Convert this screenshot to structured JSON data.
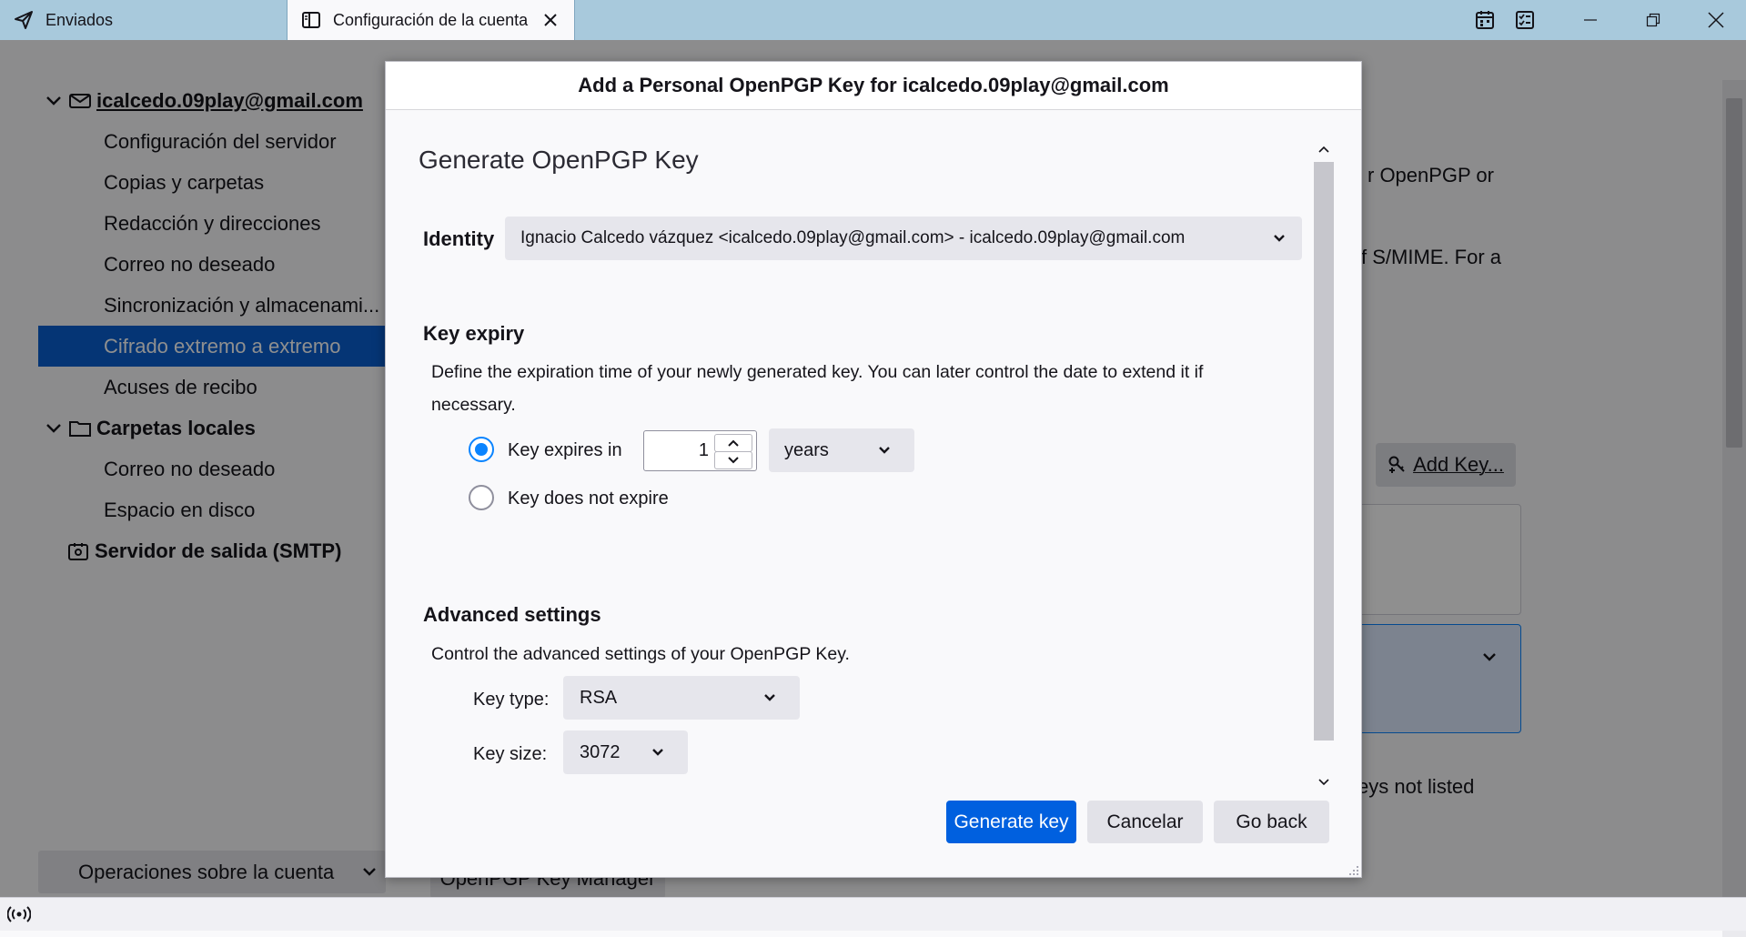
{
  "tabs": [
    {
      "label": "Enviados",
      "icon": "send-icon"
    },
    {
      "label": "Configuración de la cuenta",
      "icon": "settings-page-icon"
    }
  ],
  "window_controls": [
    "calendar-icon",
    "tasks-icon",
    "minimize-icon",
    "restore-icon",
    "close-icon"
  ],
  "sidebar": {
    "account": "icalcedo.09play@gmail.com",
    "account_items": [
      "Configuración del servidor",
      "Copias y carpetas",
      "Redacción y direcciones",
      "Correo no deseado",
      "Sincronización y almacenami...",
      "Cifrado extremo a extremo",
      "Acuses de recibo"
    ],
    "selected_item": "Cifrado extremo a extremo",
    "local_folders": "Carpetas locales",
    "local_items": [
      "Correo no deseado",
      "Espacio en disco"
    ],
    "smtp": "Servidor de salida (SMTP)",
    "account_ops": "Operaciones sobre la cuenta"
  },
  "background_main": {
    "text_fragment_1": "r OpenPGP or",
    "text_fragment_2": "f S/MIME. For a",
    "add_key": "Add Key...",
    "keys_not_listed": "eys not listed",
    "key_manager": "OpenPGP Key Manager"
  },
  "dialog": {
    "title": "Add a Personal OpenPGP Key for icalcedo.09play@gmail.com",
    "heading": "Generate OpenPGP Key",
    "identity_label": "Identity",
    "identity_value": "Ignacio Calcedo vázquez <icalcedo.09play@gmail.com> - icalcedo.09play@gmail.com",
    "key_expiry": {
      "title": "Key expiry",
      "description_line1": "Define the expiration time of your newly generated key. You can later control the date to extend it if",
      "description_line2": "necessary.",
      "expires_in_label": "Key expires in",
      "expires_value": "1",
      "unit": "years",
      "no_expire_label": "Key does not expire",
      "selected": "expires_in"
    },
    "advanced": {
      "title": "Advanced settings",
      "description": "Control the advanced settings of your OpenPGP Key.",
      "key_type_label": "Key type:",
      "key_type_value": "RSA",
      "key_size_label": "Key size:",
      "key_size_value": "3072"
    },
    "buttons": {
      "generate": "Generate key",
      "cancel": "Cancelar",
      "back": "Go back"
    }
  },
  "colors": {
    "accent": "#0060df",
    "selection": "#0a5fd1",
    "tabbar": "#a8c9dc",
    "radio": "#0a84ff"
  }
}
